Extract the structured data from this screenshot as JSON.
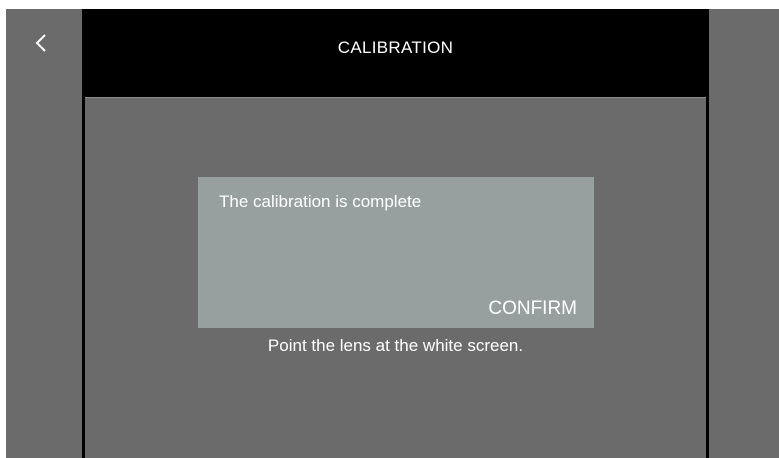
{
  "header": {
    "back_icon": "chevron-left-icon",
    "title": "CALIBRATION"
  },
  "dialog": {
    "message": "The calibration is complete",
    "confirm_label": "CONFIRM"
  },
  "instruction": "Point the lens at the white screen.",
  "colors": {
    "background": "#6b6b6b",
    "title_bar": "#000000",
    "dialog": "#979f9f",
    "text": "#ffffff"
  }
}
